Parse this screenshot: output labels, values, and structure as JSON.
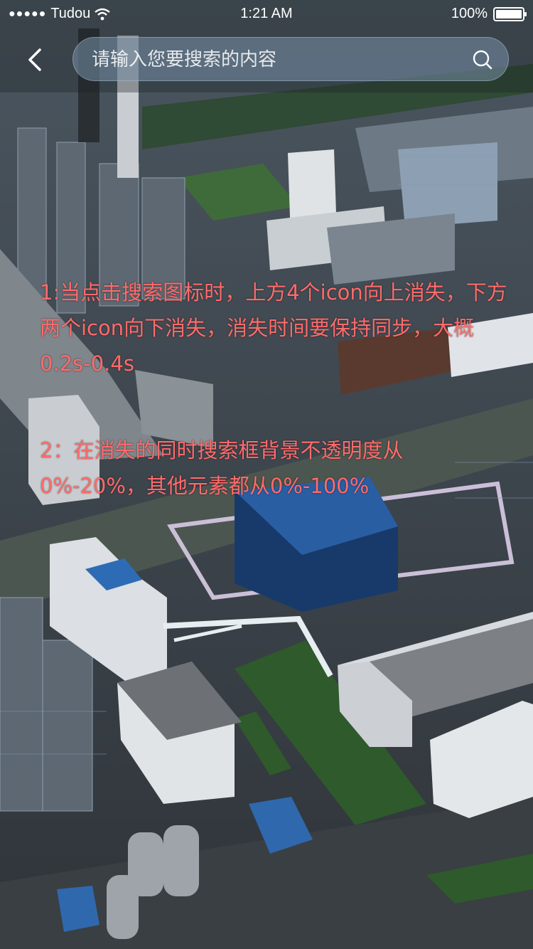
{
  "status_bar": {
    "carrier": "Tudou",
    "time": "1:21 AM",
    "battery": "100%",
    "battery_level": 1.0
  },
  "search": {
    "placeholder": "请输入您要搜索的内容"
  },
  "icons": {
    "back": "chevron-left-icon",
    "search": "magnifier-icon",
    "wifi": "wifi-icon",
    "signal": "signal-dots-icon",
    "battery": "battery-icon"
  },
  "annotations": {
    "note_1": "1:当点击搜索图标时，上方4个icon向上消失，下方两个icon向下消失，消失时间要保持同步，大概0.2s-0.4s",
    "note_2": "2：在消失的同时搜索框背景不透明度从0%-20%，其他元素都从0%-100%"
  },
  "colors": {
    "annotation_text": "#ff6b6b",
    "search_box_bg": "rgba(120,145,170,0.55)",
    "status_text": "#ffffff"
  }
}
